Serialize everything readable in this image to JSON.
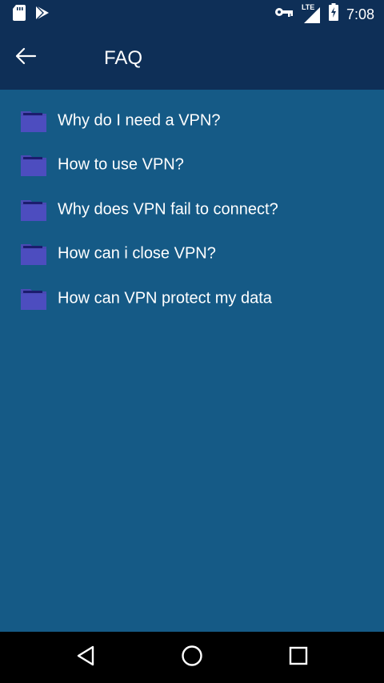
{
  "status_bar": {
    "time": "7:08",
    "network": "LTE",
    "icons": [
      "sd-card-icon",
      "play-store-icon",
      "vpn-key-icon",
      "lte-signal-icon",
      "battery-charging-icon"
    ]
  },
  "app_bar": {
    "title": "FAQ",
    "back_icon": "arrow-left-icon"
  },
  "faq": {
    "items": [
      {
        "label": "Why do I need a VPN?"
      },
      {
        "label": "How to use VPN?"
      },
      {
        "label": "Why does VPN fail to connect?"
      },
      {
        "label": "How can i close VPN?"
      },
      {
        "label": "How can VPN protect my data"
      }
    ],
    "icon": "folder-icon"
  },
  "nav_bar": {
    "icons": [
      "nav-back-icon",
      "nav-home-icon",
      "nav-recents-icon"
    ]
  },
  "colors": {
    "app_bar": "#0e2f57",
    "background": "#155a86",
    "folder": "#4a4ab5",
    "text": "#ffffff",
    "nav_bar": "#000000"
  }
}
